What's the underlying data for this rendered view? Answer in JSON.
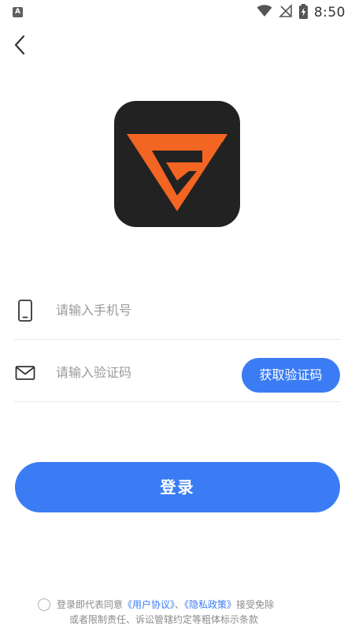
{
  "status_bar": {
    "app_indicator": "A",
    "time": "8:50"
  },
  "form": {
    "phone_placeholder": "请输入手机号",
    "code_placeholder": "请输入验证码",
    "get_code_label": "获取验证码"
  },
  "login_label": "登录",
  "agreement": {
    "prefix": "登录即代表同意",
    "user_agreement": "《用户协议》",
    "separator": "、",
    "privacy_policy": "《隐私政策》",
    "suffix": "接受免除",
    "line2": "或者限制责任、诉讼管辖约定等粗体标示条款"
  },
  "colors": {
    "accent": "#3b7cf4",
    "logo_background": "#222222",
    "logo_mark": "#f26522"
  },
  "icons": {
    "back": "chevron-left-icon",
    "phone": "phone-icon",
    "mail": "mail-icon",
    "wifi": "wifi-icon",
    "signal": "no-signal-icon",
    "battery": "battery-charging-icon"
  }
}
